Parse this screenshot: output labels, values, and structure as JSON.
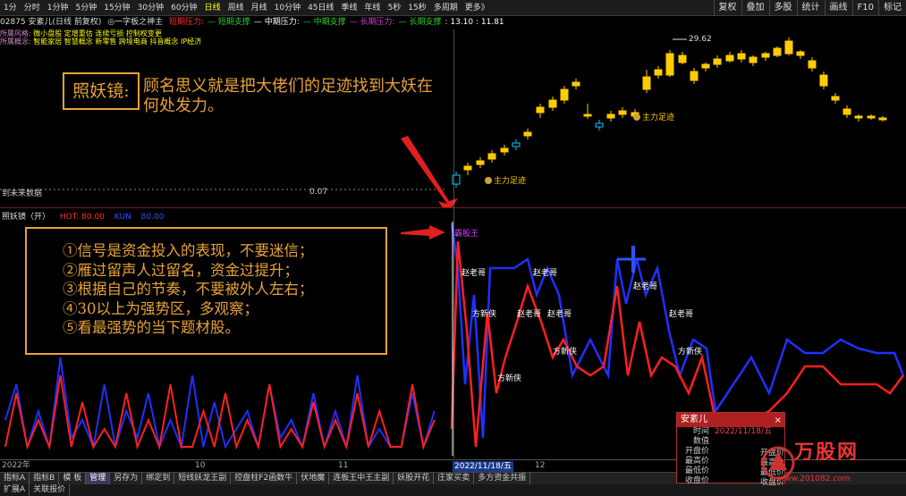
{
  "toolbar": {
    "periods": [
      "1分",
      "分时",
      "1分钟",
      "5分钟",
      "15分钟",
      "30分钟",
      "60分钟",
      "日线",
      "周线",
      "月线",
      "10分钟",
      "45日线",
      "季线",
      "年线",
      "5秒",
      "15秒",
      "多周期",
      "更多》"
    ],
    "active_period": "日线",
    "buttons": [
      "复权",
      "叠加",
      "多股",
      "统计",
      "画线",
      "F10",
      "标记"
    ]
  },
  "info": {
    "code": "02875 安紊儿(日线 前复权)",
    "indicator": "◎一字板之神主",
    "items": [
      {
        "label": "短期压力:",
        "color": "#ff3030"
      },
      {
        "label": "— 短期支撑",
        "color": "#30d030"
      },
      {
        "label": "— 中期压力:",
        "color": "#ffffff"
      },
      {
        "label": "— 中期支撑",
        "color": "#30d030"
      },
      {
        "label": "— 长期压力:",
        "color": "#d040d0"
      },
      {
        "label": "— 长期支撑",
        "color": "#30d030"
      },
      {
        "label": ": 13.10 : 11.81",
        "color": "#ffffff"
      }
    ]
  },
  "concepts": {
    "style_label": "所属风格:",
    "style_value": "微小盘股 定增重估 连续亏损 控制权变更",
    "concept_label": "所属概念:",
    "concept_value": "智能家居 智慧概念 新零售 跨境电商 抖音概念 IP经济"
  },
  "upper": {
    "high_label": "29.62",
    "unknown_text": "到未来数据",
    "value_label": "0.07",
    "markers": [
      "主力足迹",
      "主力足迹"
    ]
  },
  "annotation": {
    "box_title": "照妖镜:",
    "desc": "顾名思义就是把大佬们的足迹找到大妖在何处发力。",
    "tips": [
      "①信号是资金投入的表现，不要迷信；",
      "②雁过留声人过留名，资金过提升；",
      "③根据自己的节奏，不要被外人左右；",
      "④30以上为强势区，多观察；",
      "⑤看最强势的当下题材股。"
    ]
  },
  "indicator_panel": {
    "title": "照妖镜（开）",
    "hot": "HOT: 80.00",
    "extra": "KUN",
    "extra2": "80.00",
    "labels": [
      {
        "text": "霸股王",
        "color": "#d040ff"
      },
      {
        "text": "赵老哥",
        "color": "#ffffff"
      },
      {
        "text": "赵老哥",
        "color": "#ffffff"
      },
      {
        "text": "赵老哥",
        "color": "#ffffff"
      },
      {
        "text": "方新侠",
        "color": "#ffffff"
      },
      {
        "text": "赵老哥",
        "color": "#ffffff"
      },
      {
        "text": "赵老哥",
        "color": "#ffffff"
      },
      {
        "text": "赵老哥",
        "color": "#ffffff"
      },
      {
        "text": "方新侠",
        "color": "#ffffff"
      },
      {
        "text": "方新侠",
        "color": "#ffffff"
      },
      {
        "text": "方新侠",
        "color": "#ffffff"
      }
    ]
  },
  "date_axis": {
    "labels": [
      "2022年",
      "10",
      "11",
      "12"
    ],
    "cursor_date": "2022/11/18/五"
  },
  "tabs": [
    "指标A",
    "指标B",
    "模 板",
    "管理",
    "另存为",
    "绑定到",
    "短线妖龙王副",
    "控盘柱F2函数牛",
    "伏地魔",
    "连板王中王主副",
    "妖股开花",
    "庄家买卖",
    "多方资金共振"
  ],
  "active_tab": "管理",
  "tabs2": [
    "扩展A",
    "关联报价"
  ],
  "popup": {
    "title": "安紊儿",
    "close": "×",
    "rows": [
      {
        "k": "时间",
        "v": "2022/11/18/五"
      },
      {
        "k": "数值",
        "v": ""
      },
      {
        "k": "开盘价",
        "v": ""
      },
      {
        "k": "最高价",
        "v": ""
      },
      {
        "k": "最低价",
        "v": ""
      },
      {
        "k": "收盘价",
        "v": ""
      }
    ]
  },
  "ticker_right": [
    "开盘价",
    "最高价",
    "最低价",
    "收盘价"
  ],
  "watermark": {
    "text": "万股网",
    "url": "www.201082.com"
  },
  "colors": {
    "up": "#ffcc00",
    "down": "#00ccff",
    "blue_line": "#2030ff",
    "red_line": "#ff2020",
    "accent": "#e8a23a"
  }
}
